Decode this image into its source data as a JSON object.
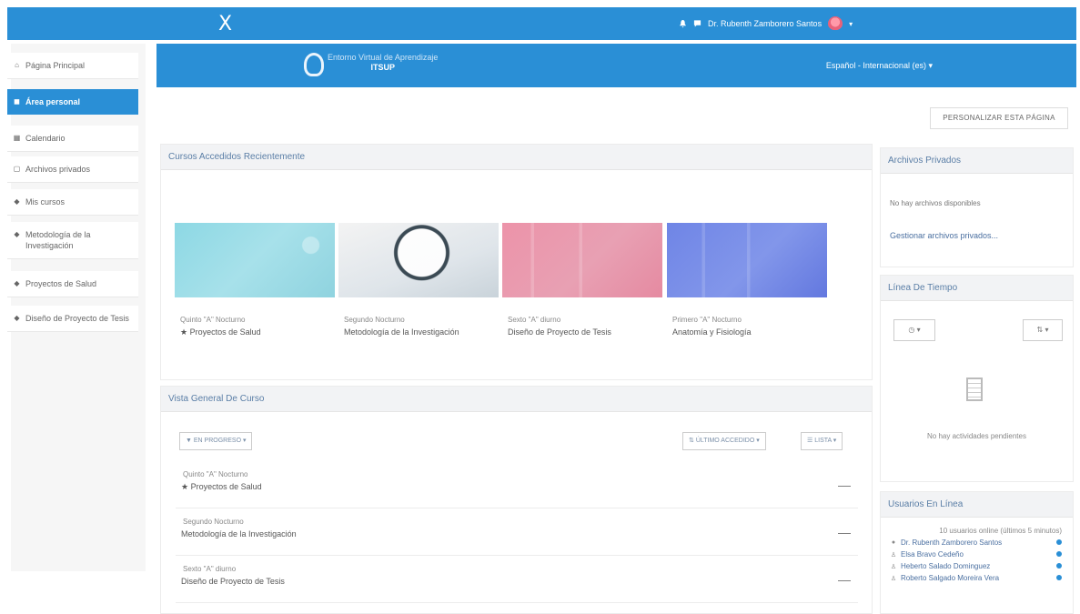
{
  "topbar": {
    "close_glyph": "X",
    "user_name": "Dr. Rubenth Zamborero Santos",
    "caret": "▾",
    "accent": "#2a8fd6"
  },
  "sidebar": {
    "items": [
      {
        "icon": "home-icon",
        "glyph": "⌂",
        "label": "Página Principal"
      },
      {
        "icon": "dashboard-icon",
        "glyph": "◼",
        "label": "Área personal"
      },
      {
        "icon": "calendar-icon",
        "glyph": "▦",
        "label": "Calendario"
      },
      {
        "icon": "file-icon",
        "glyph": "▢",
        "label": "Archivos privados"
      },
      {
        "icon": "graduation-cap-icon",
        "glyph": "◆",
        "label": "Mis cursos"
      },
      {
        "icon": "graduation-cap-icon",
        "glyph": "◆",
        "label": "Metodología de la Investigación"
      },
      {
        "icon": "graduation-cap-icon",
        "glyph": "◆",
        "label": "Proyectos de Salud"
      },
      {
        "icon": "graduation-cap-icon",
        "glyph": "◆",
        "label": "Diseño de Proyecto de Tesis"
      }
    ]
  },
  "banner": {
    "logo_line1": "Entorno Virtual de Aprendizaje",
    "logo_line2": "ITSUP",
    "language": "Español - Internacional (es)"
  },
  "customize_button": "PERSONALIZAR ESTA PÁGINA",
  "recent_courses": {
    "title": "Cursos Accedidos Recientemente",
    "courses": [
      {
        "category": "Quinto \"A\" Nocturno",
        "name": "Proyectos de Salud"
      },
      {
        "category": "Segundo Nocturno",
        "name": "Metodología de la Investigación"
      },
      {
        "category": "Sexto \"A\" diurno",
        "name": "Diseño de Proyecto de Tesis"
      },
      {
        "category": "Primero \"A\" Nocturno",
        "name": "Anatomía y Fisiología"
      }
    ]
  },
  "course_overview": {
    "title": "Vista General De Curso",
    "filter": "EN PROGRESO",
    "sort": "ÚLTIMO ACCEDIDO",
    "view": "LISTA",
    "items": [
      {
        "category": "Quinto \"A\" Nocturno",
        "name": "Proyectos de Salud"
      },
      {
        "category": "Segundo Nocturno",
        "name": "Metodología de la Investigación"
      },
      {
        "category": "Sexto \"A\" diurno",
        "name": "Diseño de Proyecto de Tesis"
      }
    ]
  },
  "private_files": {
    "title": "Archivos Privados",
    "empty": "No hay archivos disponibles",
    "manage": "Gestionar archivos privados..."
  },
  "timeline": {
    "title": "Línea De Tiempo",
    "empty": "No hay actividades pendientes"
  },
  "online_users": {
    "title": "Usuarios En Línea",
    "subtitle": "10 usuarios online (últimos 5 minutos)",
    "users": [
      "Dr. Rubenth Zamborero Santos",
      "Elsa Bravo Cedeño",
      "Heberto Salado Dominguez",
      "Roberto Salgado Moreira Vera"
    ]
  }
}
